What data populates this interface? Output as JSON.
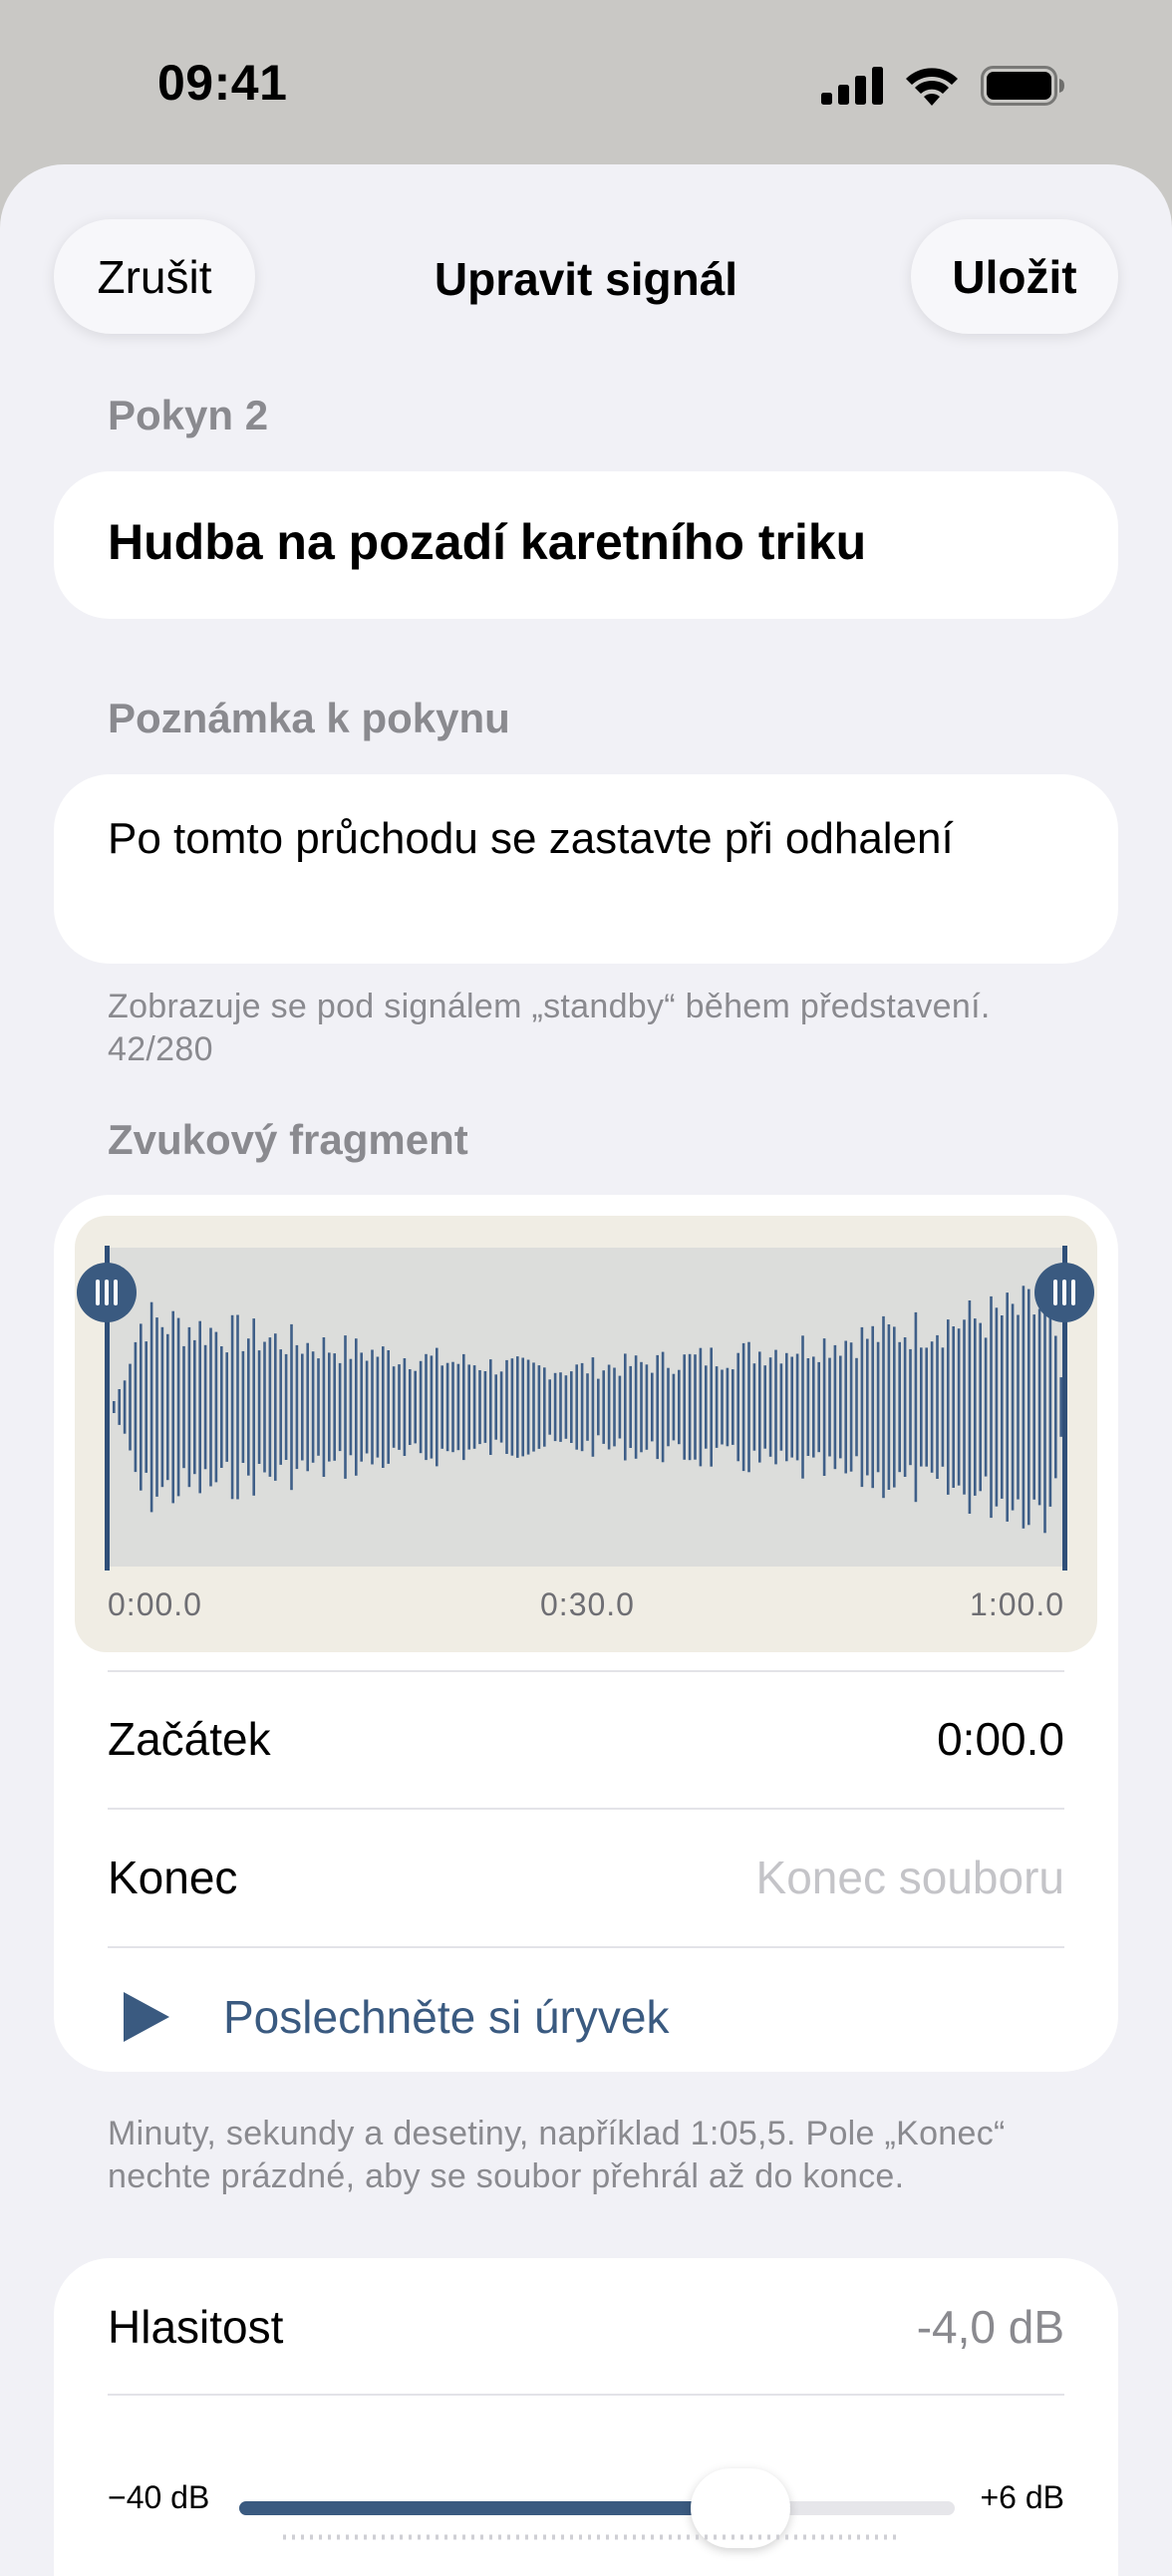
{
  "status_bar": {
    "time": "09:41"
  },
  "nav": {
    "cancel_label": "Zrušit",
    "title": "Upravit signál",
    "save_label": "Uložit"
  },
  "cue": {
    "section_label": "Pokyn 2",
    "name": "Hudba na pozadí karetního triku"
  },
  "note": {
    "section_label": "Poznámka k pokynu",
    "value": "Po tomto průchodu se zastavte při odhalení",
    "help": "Zobrazuje se pod signálem „standby“ během představení.",
    "counter": "42/280"
  },
  "clip": {
    "section_label": "Zvukový fragment",
    "timeline": {
      "start_label": "0:00.0",
      "mid_label": "0:30.0",
      "end_label": "1:00.0"
    },
    "start_row": {
      "label": "Začátek",
      "value": "0:00.0"
    },
    "end_row": {
      "label": "Konec",
      "placeholder": "Konec souboru"
    },
    "preview_label": "Poslechněte si úryvek",
    "help": "Minuty, sekundy a desetiny, například 1:05,5. Pole „Konec“ nechte prázdné, aby se soubor přehrál až do konce."
  },
  "volume": {
    "label": "Hlasitost",
    "value": "-4,0 dB",
    "min_label": "−40 dB",
    "max_label": "+6 dB",
    "fraction": 0.77
  },
  "colors": {
    "accent": "#3a5a80",
    "background": "#f1f1f6",
    "card": "#ffffff",
    "secondary_text": "#8a8a8f"
  }
}
